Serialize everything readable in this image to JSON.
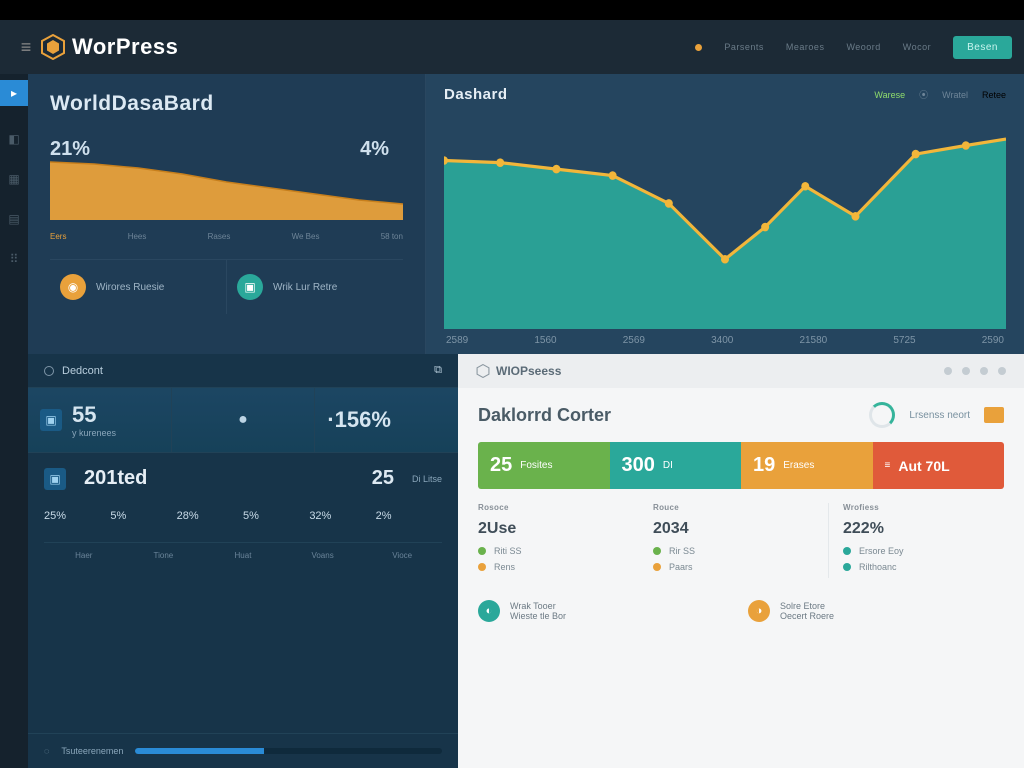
{
  "header": {
    "brand": "WorPress",
    "nav": [
      "Parsents",
      "Mearoes",
      "Weoord",
      "Wocor"
    ],
    "nav_btn": "Besen"
  },
  "panel_left": {
    "title": "WorldDasaBard",
    "pct_left": "21%",
    "pct_right": "4%",
    "axis": [
      "Eers",
      "Hees",
      "Rases",
      "We Bes",
      "58 ton"
    ],
    "card1": "Wirores Ruesie",
    "card2": "Wrik Lur Retre"
  },
  "panel_right": {
    "title": "Dashard",
    "links": [
      "Warese",
      "Wratel",
      "Retee"
    ],
    "axis": [
      "2589",
      "1560",
      "2569",
      "3400",
      "21580",
      "5725",
      "2590"
    ]
  },
  "panel_bl": {
    "head": "Dedcont",
    "stat1_big": "55",
    "stat1_sub": "y kurenees",
    "stat2_dot": "●",
    "stat3_big": "·156%",
    "row_n1": "201ted",
    "row_n2": "25",
    "row_t2": "Di Litse",
    "pcts": [
      "25%",
      "5%",
      "28%",
      "5%",
      "32%",
      "2%"
    ],
    "tabs": [
      "Haer",
      "Tione",
      "Huat",
      "Voans",
      "Vioce"
    ],
    "foot": "Tsuteerenemen"
  },
  "panel_br": {
    "brand": "WIOPseess",
    "title": "Daklorrd Corter",
    "right_label": "Lrsenss neort",
    "tiles": [
      {
        "n": "25",
        "t": "Fosites"
      },
      {
        "n": "300",
        "t": "DI"
      },
      {
        "n": "19",
        "t": "Erases"
      },
      {
        "n": "Aut 70L",
        "t": ""
      }
    ],
    "col1": {
      "h": "Rosoce",
      "v": "2Use",
      "l1": "Riti SS",
      "l2": "Rens"
    },
    "col2": {
      "h": "Rouce",
      "v": "2034",
      "l1": "Rir SS",
      "l2": "Paars"
    },
    "col3": {
      "h": "Wrofiess",
      "v": "222%",
      "l1": "Ersore Eoy",
      "l2": "Rilthoanc"
    },
    "foot1": {
      "t1": "Wrak Tooer",
      "t2": "Wieste tle Bor"
    },
    "foot2": {
      "t1": "Solre Etore",
      "t2": "Oecert Roere"
    }
  },
  "chart_data": [
    {
      "type": "area",
      "title": "WorldDasaBard mini area",
      "categories": [
        "Eers",
        "Hees",
        "Rases",
        "We Bes",
        "58 ton"
      ],
      "values": [
        72,
        70,
        66,
        58,
        50,
        42,
        36,
        30
      ],
      "color": "#e9a13b",
      "ylim": [
        0,
        100
      ]
    },
    {
      "type": "area",
      "title": "Dashard main area + line",
      "categories": [
        "2589",
        "1560",
        "2569",
        "3400",
        "21580",
        "5725",
        "2590"
      ],
      "series": [
        {
          "name": "area",
          "type": "area",
          "color": "#2aa89a",
          "values": [
            150,
            148,
            142,
            136,
            110,
            70,
            95,
            132,
            105,
            160,
            170
          ]
        },
        {
          "name": "line",
          "type": "line",
          "color": "#f2b63a",
          "values": [
            150,
            148,
            142,
            136,
            110,
            70,
            95,
            132,
            105,
            160,
            170
          ]
        }
      ],
      "ylim": [
        0,
        200
      ]
    }
  ]
}
